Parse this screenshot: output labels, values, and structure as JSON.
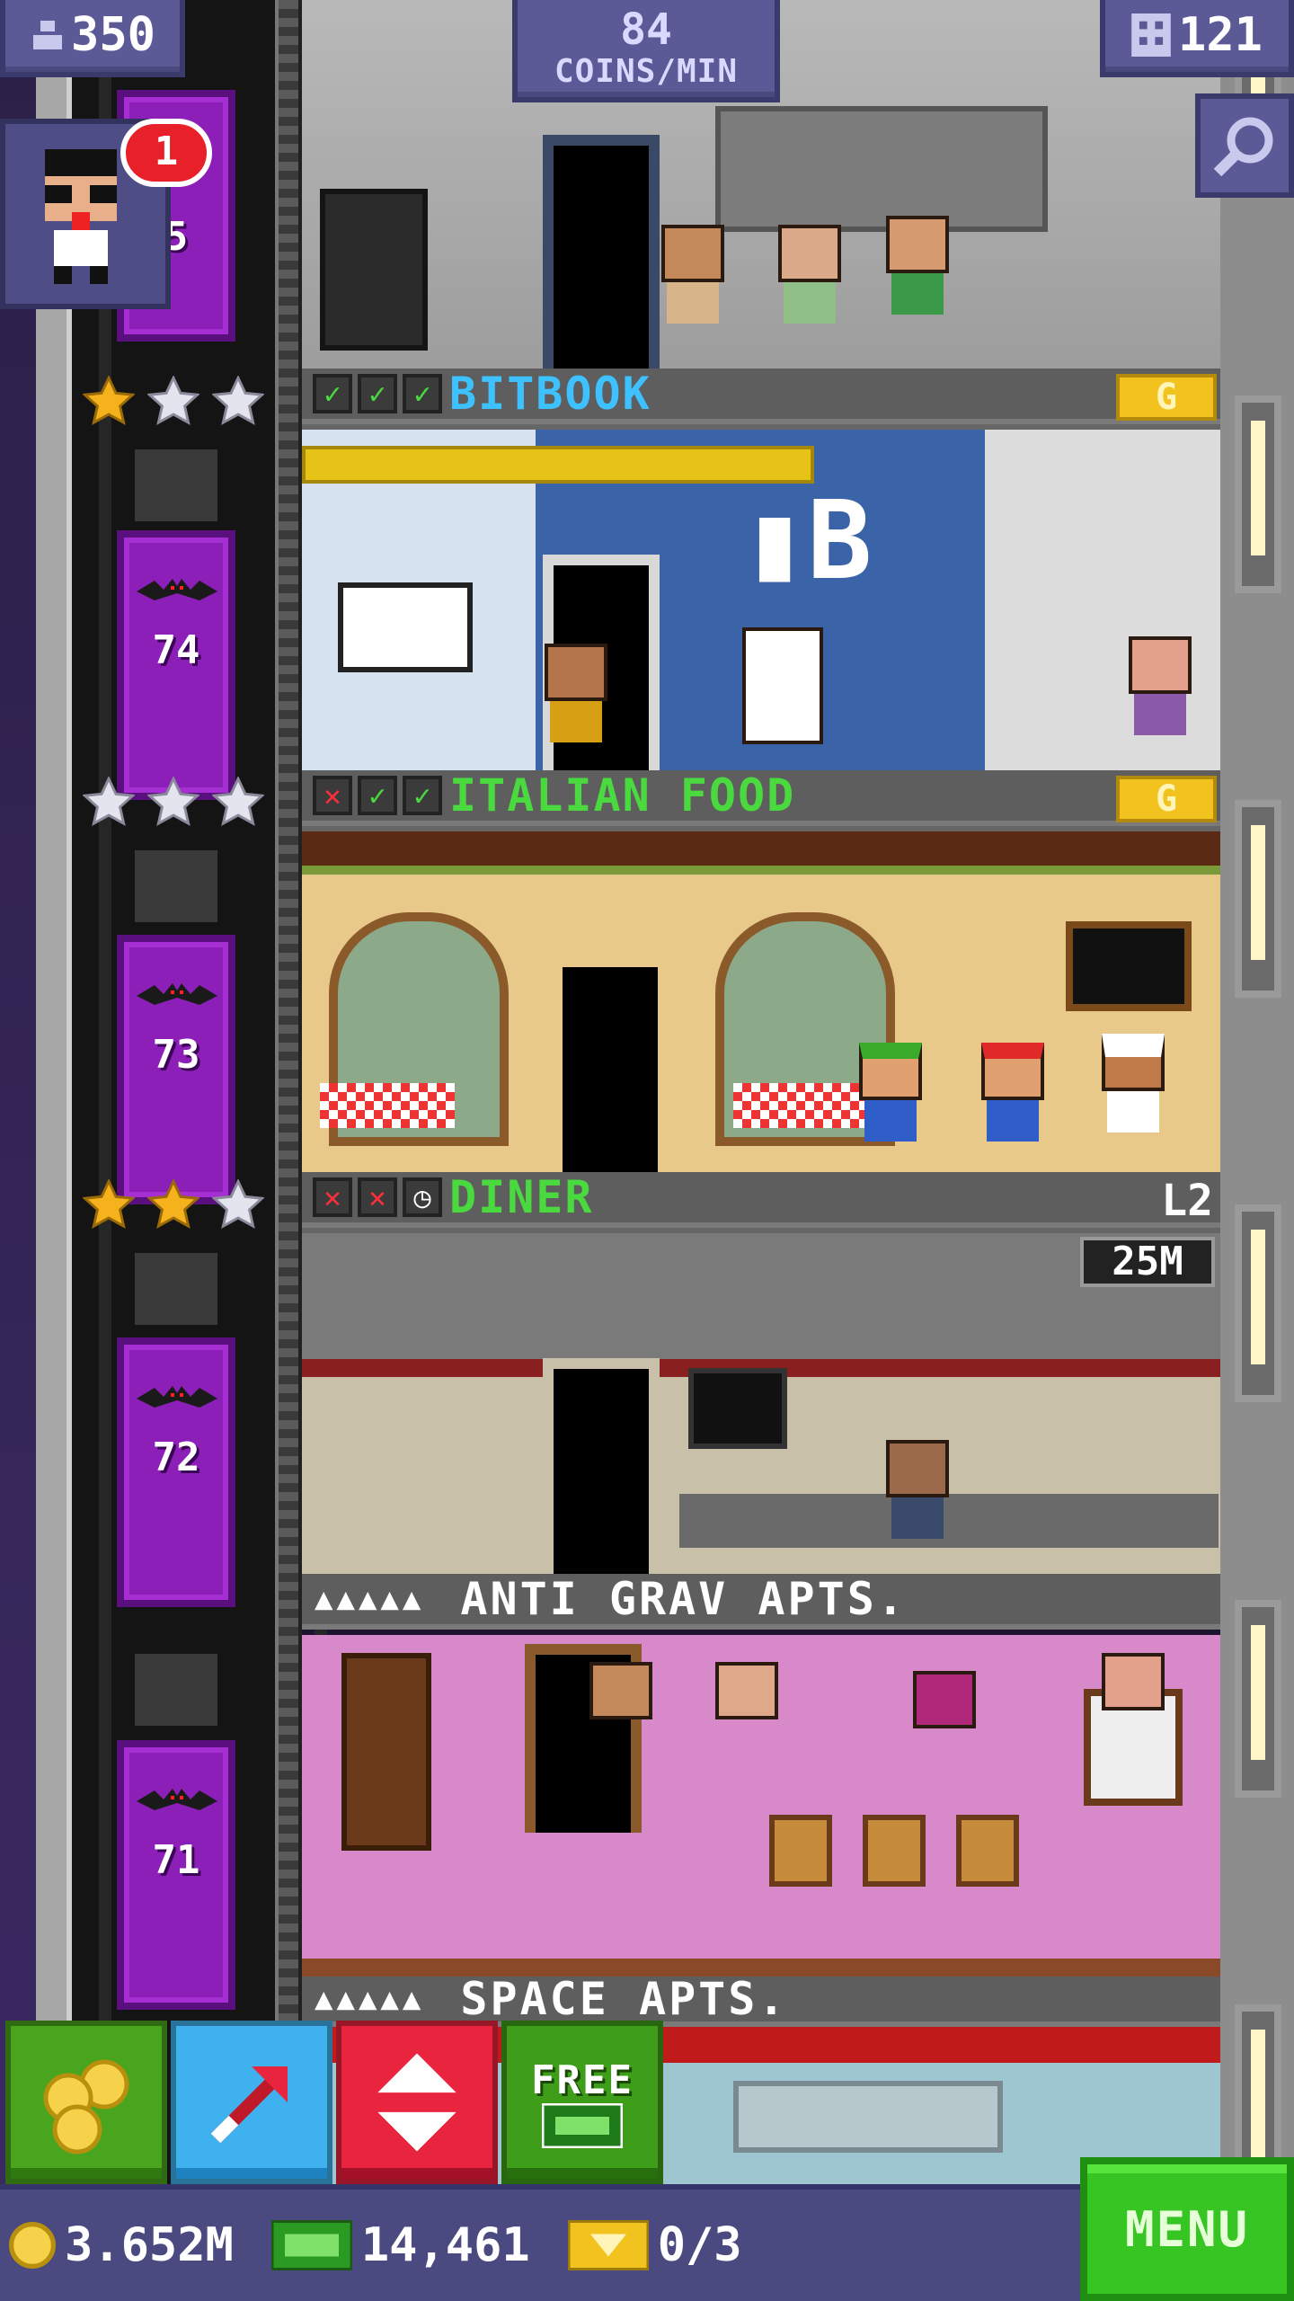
{
  "hud": {
    "population": "350",
    "coins_per_min_value": "84",
    "coins_per_min_unit": "COINS/MIN",
    "floor_count": "121",
    "vip_notifications": "1"
  },
  "elevator": {
    "visible_floor_numbers": [
      "5",
      "74",
      "73",
      "72",
      "71"
    ]
  },
  "floors": [
    {
      "name": "BITBOOK",
      "checks": [
        "ok",
        "ok",
        "ok"
      ],
      "stars_gold": 1,
      "stars_total": 3,
      "badge": "G",
      "name_color": "#3ec2ff"
    },
    {
      "name": "ITALIAN FOOD",
      "checks": [
        "no",
        "ok",
        "ok"
      ],
      "stars_gold": 0,
      "stars_total": 3,
      "badge": "G",
      "name_color": "#4ad93e"
    },
    {
      "name": "DINER",
      "checks": [
        "no",
        "no",
        "clock"
      ],
      "stars_gold": 2,
      "stars_total": 3,
      "level": "L2",
      "timer": "25M",
      "name_color": "#4ad93e"
    }
  ],
  "residences": [
    {
      "name": "ANTI GRAV APTS.",
      "people": "▲▲▲▲▲"
    },
    {
      "name": "SPACE APTS.",
      "people": "▲▲▲▲▲"
    }
  ],
  "toolbar": {
    "free_label": "FREE"
  },
  "currency": {
    "coins": "3.652M",
    "bux": "14,461",
    "tickets": "0/3"
  },
  "menu_label": "MENU",
  "colors": {
    "hud_bg": "#5b5a97",
    "elevator_purple": "#8c1fb7",
    "menu_green": "#36c522",
    "gold": "#f2c31f"
  }
}
